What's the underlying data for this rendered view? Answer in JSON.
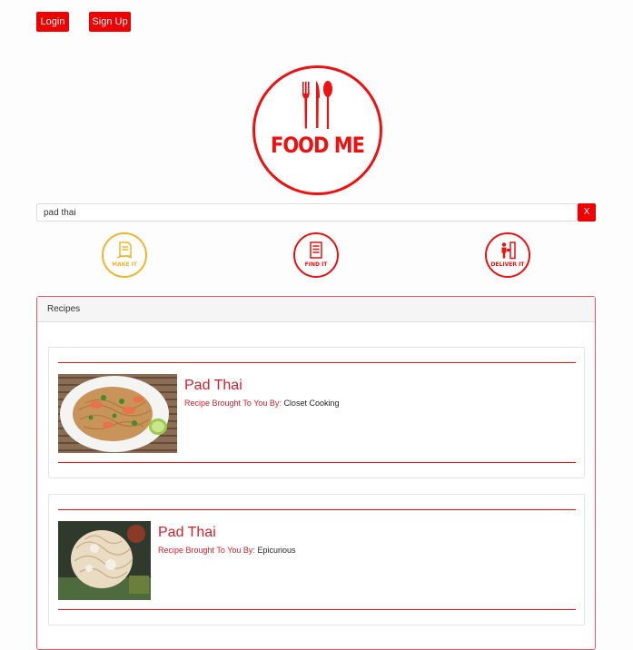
{
  "auth": {
    "login_label": "Login",
    "signup_label": "Sign Up"
  },
  "logo": {
    "text": "FOOD ME",
    "icon": "fork-knife-spoon-icon"
  },
  "search": {
    "value": "pad thai",
    "clear_label": "X"
  },
  "modes": [
    {
      "label": "MAKE IT",
      "icon": "recipe-book-icon",
      "color": "#f0b52a"
    },
    {
      "label": "FIND IT",
      "icon": "menu-icon",
      "color": "#ee1111"
    },
    {
      "label": "DELIVER IT",
      "icon": "delivery-door-icon",
      "color": "#ee1111"
    }
  ],
  "panel": {
    "header": "Recipes",
    "recipes": [
      {
        "title": "Pad Thai",
        "credit_label": "Recipe Brought To You By:",
        "source": "Closet Cooking"
      },
      {
        "title": "Pad Thai",
        "credit_label": "Recipe Brought To You By:",
        "source": "Epicurious"
      }
    ]
  },
  "colors": {
    "brand": "#ee0000",
    "accent_yellow": "#f0b52a"
  }
}
